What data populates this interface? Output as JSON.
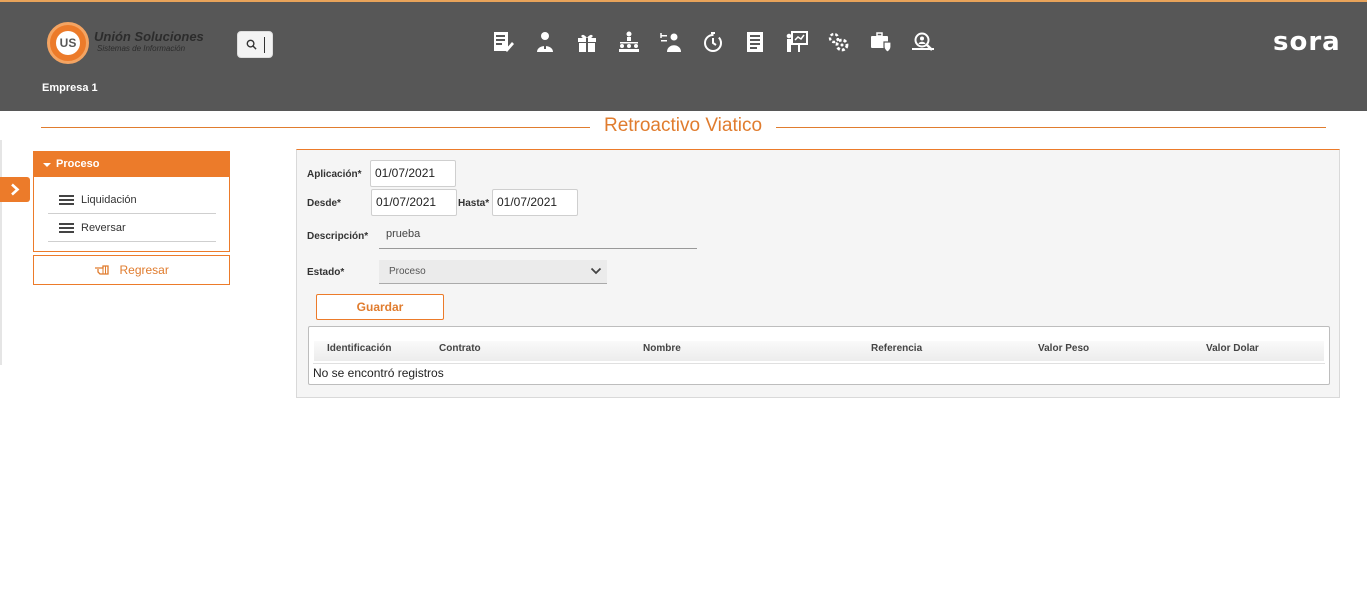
{
  "header": {
    "logo_mark": "US",
    "logo_title": "Unión Soluciones",
    "logo_subtitle": "Sistemas de Información",
    "brand": "sora",
    "company": "Empresa 1",
    "accent_color": "#ec7b2a",
    "bar_color": "#575757",
    "modules": [
      "payroll-edit-icon",
      "employee-icon",
      "gift-icon",
      "org-chart-icon",
      "person-switch-icon",
      "timer-icon",
      "document-list-icon",
      "presentation-icon",
      "gears-icon",
      "briefcase-shield-icon",
      "search-person-icon"
    ]
  },
  "page": {
    "title": "Retroactivo Viatico"
  },
  "menu": {
    "section": "Proceso",
    "items": [
      {
        "label": "Liquidación",
        "icon": "list-icon"
      },
      {
        "label": "Reversar",
        "icon": "list-icon"
      }
    ],
    "back_label": "Regresar"
  },
  "form": {
    "aplicacion_label": "Aplicación*",
    "aplicacion_value": "01/07/2021",
    "desde_label": "Desde*",
    "desde_value": "01/07/2021",
    "hasta_label": "Hasta*",
    "hasta_value": "01/07/2021",
    "descripcion_label": "Descripción*",
    "descripcion_value": "prueba",
    "estado_label": "Estado*",
    "estado_value": "Proceso",
    "save_label": "Guardar"
  },
  "table": {
    "columns": [
      "Identificación",
      "Contrato",
      "Nombre",
      "Referencia",
      "Valor Peso",
      "Valor Dolar"
    ],
    "empty_message": "No se encontró registros"
  }
}
